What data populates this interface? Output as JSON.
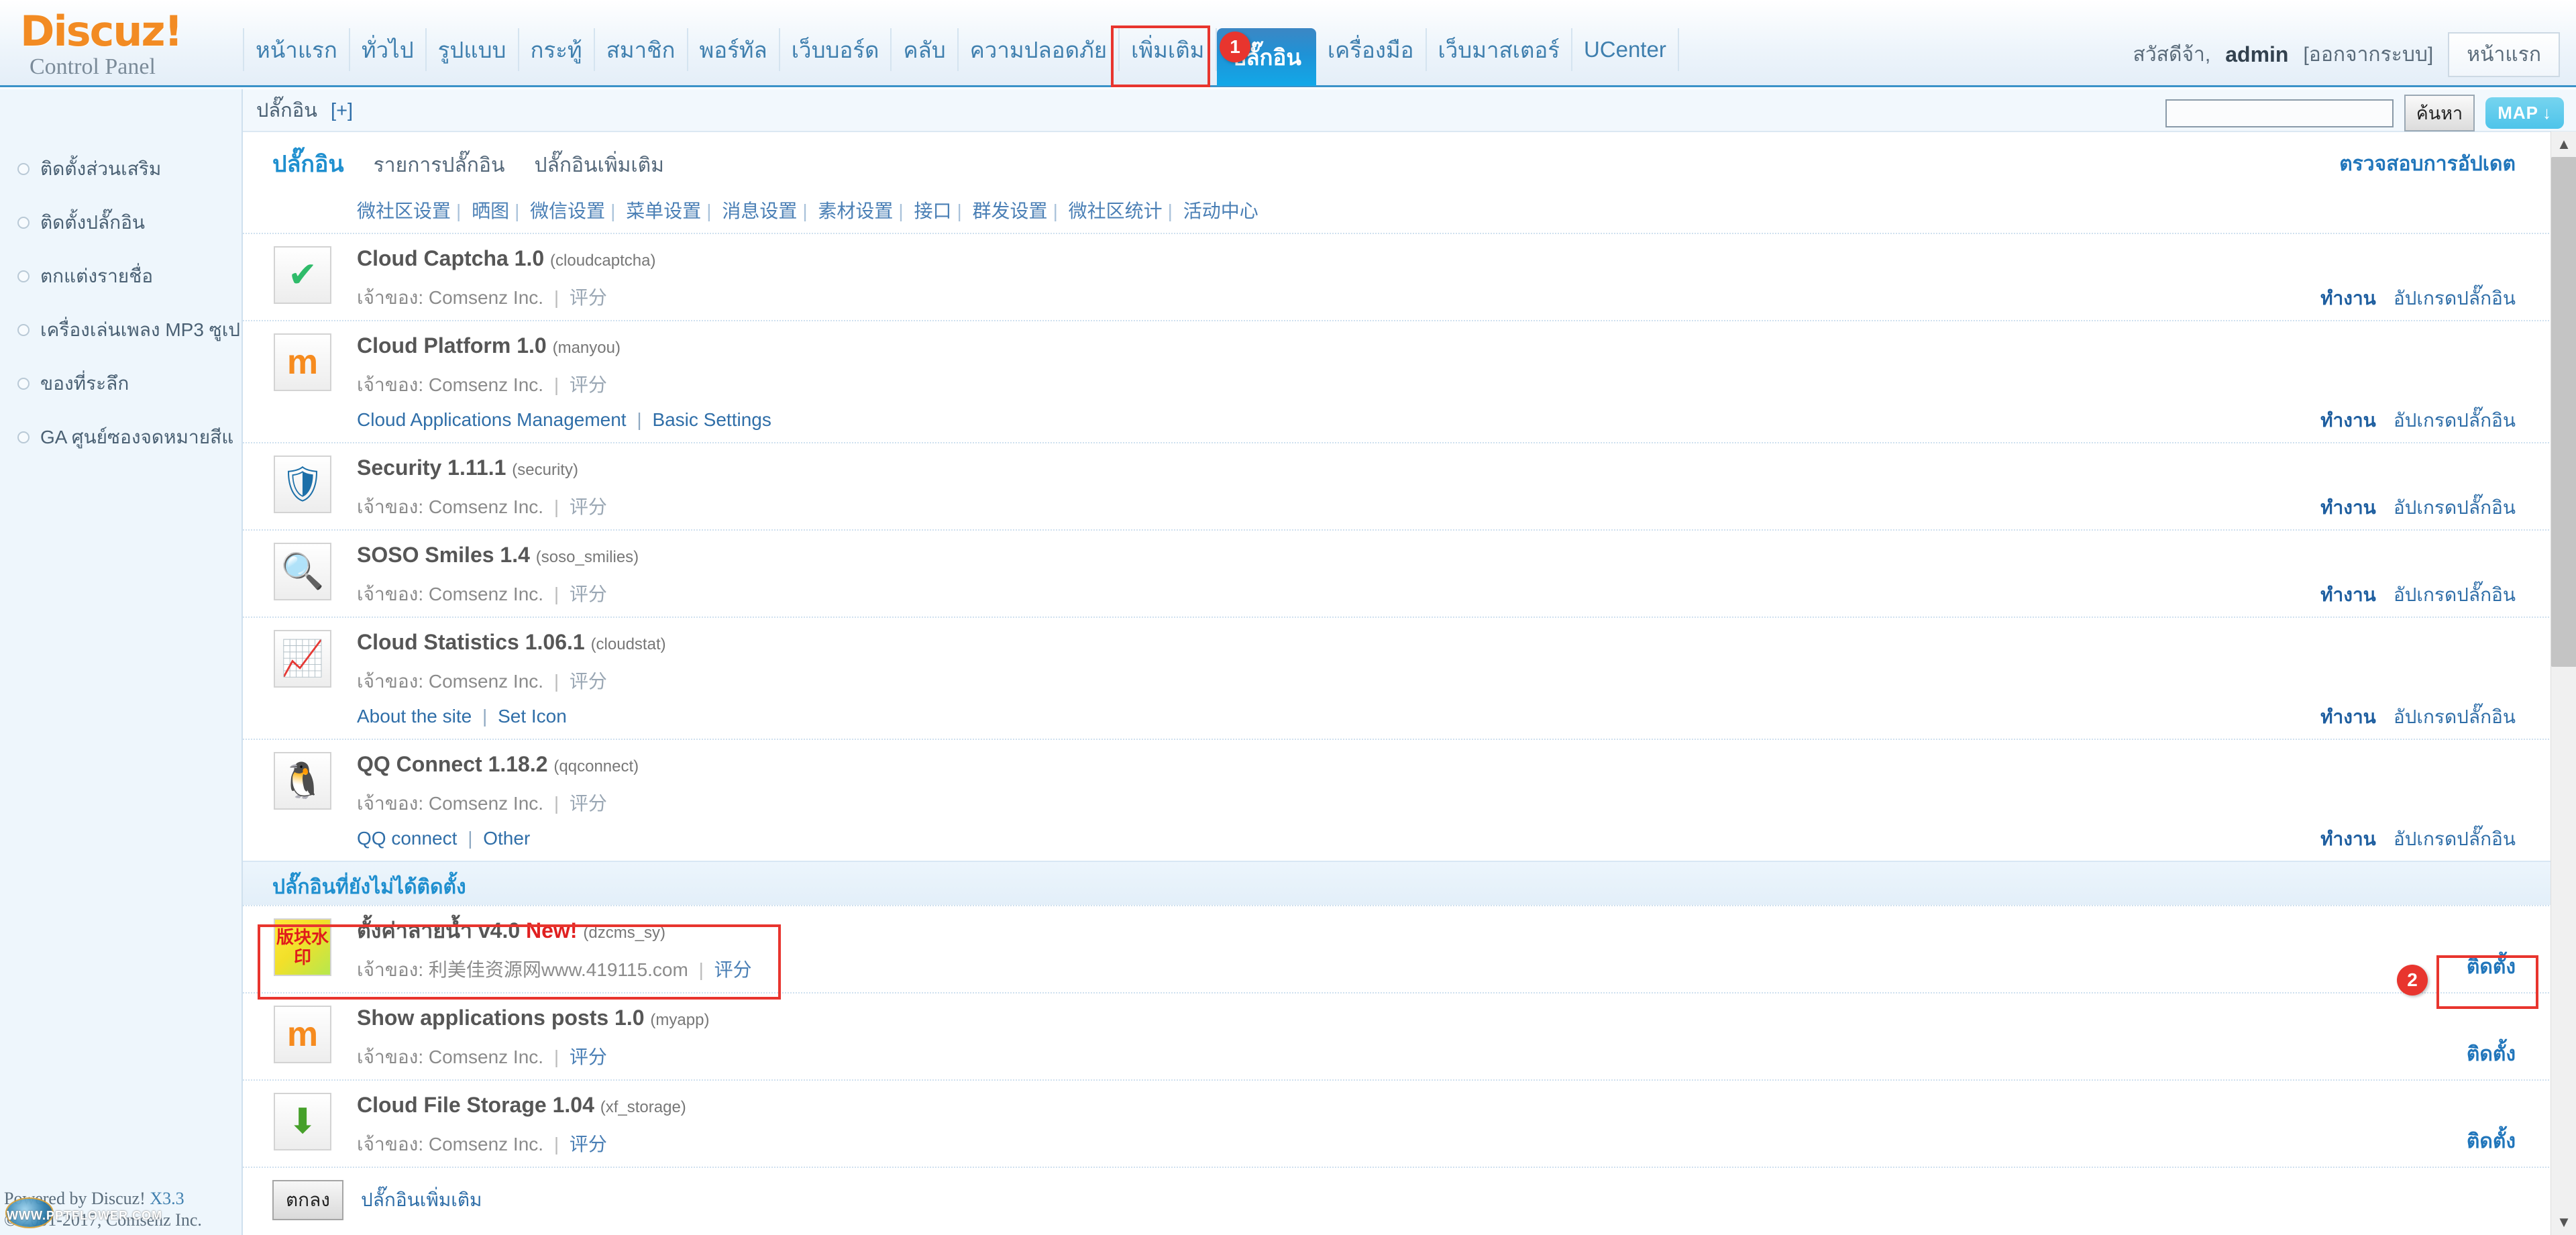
{
  "header": {
    "logo_main": "Discuz!",
    "logo_sub": "Control Panel",
    "nav": [
      {
        "label": "หน้าแรก",
        "active": false
      },
      {
        "label": "ทั่วไป",
        "active": false
      },
      {
        "label": "รูปแบบ",
        "active": false
      },
      {
        "label": "กระทู้",
        "active": false
      },
      {
        "label": "สมาชิก",
        "active": false
      },
      {
        "label": "พอร์ทัล",
        "active": false
      },
      {
        "label": "เว็บบอร์ด",
        "active": false
      },
      {
        "label": "คลับ",
        "active": false
      },
      {
        "label": "ความปลอดภัย",
        "active": false
      },
      {
        "label": "เพิ่มเติม",
        "active": false
      },
      {
        "label": "ปลั๊กอิน",
        "active": true
      },
      {
        "label": "เครื่องมือ",
        "active": false
      },
      {
        "label": "เว็บมาสเตอร์",
        "active": false
      },
      {
        "label": "UCenter",
        "active": false
      }
    ],
    "greeting": "สวัสดีจ้า,",
    "username": "admin",
    "logout": "[ออกจากระบบ]",
    "home_button": "หน้าแรก",
    "badge_1": "1"
  },
  "subheader": {
    "breadcrumb": "ปลั๊กอิน",
    "breadcrumb_plus": "[+]",
    "search_value": "",
    "search_placeholder": "",
    "search_button": "ค้นหา",
    "map_button": "MAP",
    "map_icon": "arrow-down-icon"
  },
  "sidebar": {
    "items": [
      {
        "label": "ติดตั้งส่วนเสริม"
      },
      {
        "label": "ติดตั้งปลั๊กอิน"
      },
      {
        "label": "ตกแต่งรายชื่อ"
      },
      {
        "label": "เครื่องเล่นเพลง MP3 ซูเป"
      },
      {
        "label": "ของที่ระลึก"
      },
      {
        "label": "GA ศูนย์ซองจดหมายสีแ"
      }
    ],
    "footer_line1": "Powered by Discuz!",
    "footer_version": "X3.3",
    "footer_line2": "© 2001-2017, Comsenz Inc.",
    "footer_watermark": "WWW.PPTFLOWER.COM"
  },
  "main": {
    "tab_main": "ปลั๊กอิน",
    "tabs": [
      {
        "label": "รายการปลั๊กอิน"
      },
      {
        "label": "ปลั๊กอินเพิ่มเติม"
      }
    ],
    "check_update": "ตรวจสอบการอัปเดต",
    "sublinks": [
      "微社区设置",
      "晒图",
      "微信设置",
      "菜单设置",
      "消息设置",
      "素材设置",
      "接口",
      "群发设置",
      "微社区统计",
      "活动中心"
    ],
    "owner_label": "เจ้าของ:",
    "rate_label": "评分",
    "action_enable": "ทำงาน",
    "action_upgrade": "อัปเกรดปลั๊กอิน",
    "action_install": "ติดตั้ง",
    "installed": [
      {
        "name": "Cloud Captcha 1.0",
        "id": "(cloudcaptcha)",
        "owner": "Comsenz Inc.",
        "icon": "check-shield-icon",
        "glyph": "✅",
        "links": [],
        "has_actions": true
      },
      {
        "name": "Cloud Platform 1.0",
        "id": "(manyou)",
        "owner": "Comsenz Inc.",
        "icon": "manyou-m-icon",
        "glyph": "ⓜ",
        "links": [
          "Cloud Applications Management",
          "Basic Settings"
        ],
        "has_actions": true
      },
      {
        "name": "Security 1.11.1",
        "id": "(security)",
        "owner": "Comsenz Inc.",
        "icon": "shield-icon",
        "glyph": "🛡",
        "links": [],
        "has_actions": true
      },
      {
        "name": "SOSO Smiles 1.4",
        "id": "(soso_smilies)",
        "owner": "Comsenz Inc.",
        "icon": "smiley-search-icon",
        "glyph": "🔍",
        "links": [],
        "has_actions": true
      },
      {
        "name": "Cloud Statistics 1.06.1",
        "id": "(cloudstat)",
        "owner": "Comsenz Inc.",
        "icon": "chart-icon",
        "glyph": "📊",
        "links": [
          "About the site",
          "Set Icon"
        ],
        "has_actions": true
      },
      {
        "name": "QQ Connect 1.18.2",
        "id": "(qqconnect)",
        "owner": "Comsenz Inc.",
        "icon": "penguin-icon",
        "glyph": "🐧",
        "links": [
          "QQ connect",
          "Other"
        ],
        "has_actions": true
      }
    ],
    "uninstalled_heading": "ปลั๊กอินที่ยังไม่ได้ติดตั้ง",
    "uninstalled": [
      {
        "name": "ตั้งค่าลายน้ำ",
        "version": "v4.0",
        "new_tag": "New!",
        "id": "(dzcms_sy)",
        "owner": "利美佳资源网www.419115.com",
        "icon": "watermark-icon",
        "glyph": "版块水印",
        "highlighted": true
      },
      {
        "name": "Show applications posts 1.0",
        "version": "",
        "new_tag": "",
        "id": "(myapp)",
        "owner": "Comsenz Inc.",
        "icon": "manyou-m-icon",
        "glyph": "ⓜ",
        "highlighted": false
      },
      {
        "name": "Cloud File Storage 1.04",
        "version": "",
        "new_tag": "",
        "id": "(xf_storage)",
        "owner": "Comsenz Inc.",
        "icon": "cloud-download-icon",
        "glyph": "🌐",
        "highlighted": false
      }
    ],
    "badge_2": "2",
    "ok_button": "ตกลง",
    "more_link": "ปลั๊กอินเพิ่มเติม"
  },
  "scrollbar": {
    "up_arrow": "▲",
    "down_arrow": "▼"
  },
  "colors": {
    "accent_blue": "#1f8fcf",
    "nav_active": "#1f92d6",
    "highlight_red": "#e8352e",
    "link_blue": "#2f6ea8",
    "logo_orange": "#f28b23"
  }
}
